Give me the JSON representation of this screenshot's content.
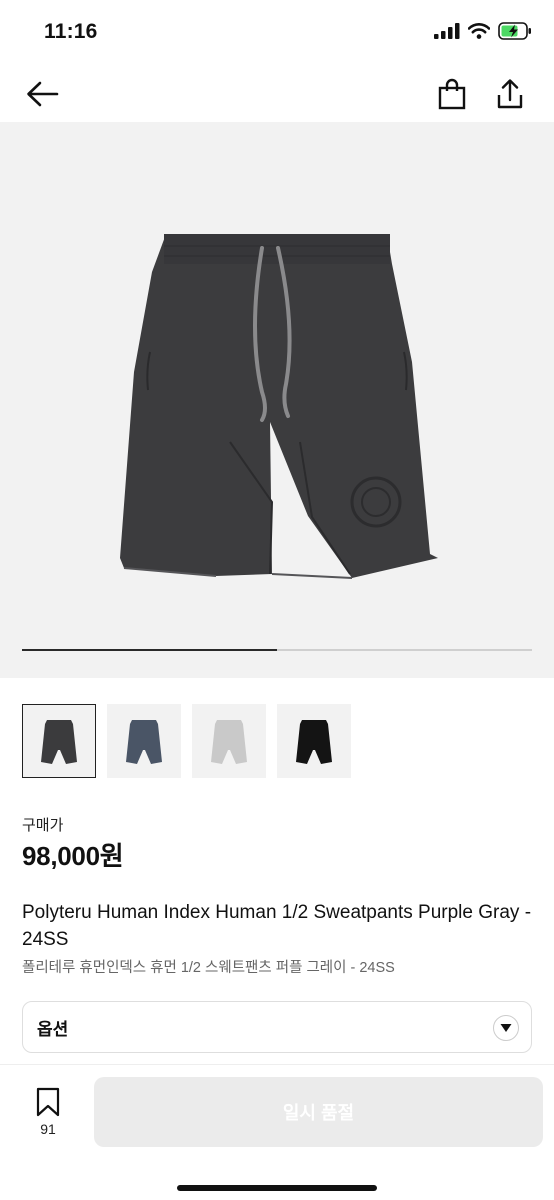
{
  "status": {
    "time": "11:16",
    "icons": [
      "cellular-signal-icon",
      "wifi-icon",
      "battery-charging-icon"
    ],
    "battery_color": "#4cd964"
  },
  "nav": {
    "icons": [
      "back-arrow-icon",
      "shopping-bag-icon",
      "share-icon"
    ]
  },
  "hero": {
    "image_icon": "shorts-illustration",
    "background": "#f2f2f2",
    "carousel_progress": 0.5
  },
  "thumbnails": [
    {
      "color": "#3b3b3d",
      "selected": true
    },
    {
      "color": "#4a5566",
      "selected": false
    },
    {
      "color": "#c9c9c9",
      "selected": false
    },
    {
      "color": "#141414",
      "selected": false
    }
  ],
  "product": {
    "price_label": "구매가",
    "price": "98,000원",
    "title_en": "Polyteru Human Index Human 1/2 Sweatpants Purple Gray - 24SS",
    "title_ko": "폴리테루 휴먼인덱스 휴먼 1/2 스웨트팬츠 퍼플 그레이 - 24SS"
  },
  "option": {
    "label": "옵션",
    "icon": "chevron-down-icon"
  },
  "bottom": {
    "wish_icon": "bookmark-icon",
    "wish_count": "91",
    "buy_label": "일시 품절",
    "buy_bg": "#ebebeb"
  }
}
